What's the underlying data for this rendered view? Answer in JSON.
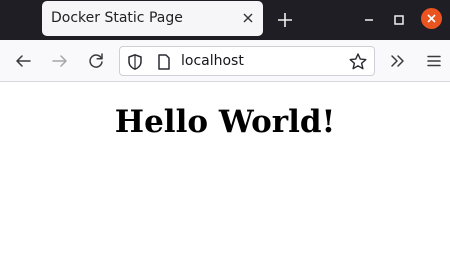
{
  "tab": {
    "title": "Docker Static Page"
  },
  "toolbar": {
    "url": "localhost"
  },
  "page": {
    "heading": "Hello World!"
  },
  "icons": {
    "tab_close": "close-icon",
    "new_tab": "plus-icon",
    "minimize": "minimize-icon",
    "maximize": "maximize-icon",
    "window_close": "window-close-icon",
    "back": "arrow-left-icon",
    "forward": "arrow-right-icon",
    "reload": "reload-icon",
    "tracking_protection": "shield-icon",
    "page_info": "page-icon",
    "bookmark": "star-icon",
    "overflow": "chevron-double-right-icon",
    "menu": "hamburger-menu-icon"
  },
  "colors": {
    "tabbar_bg": "#1f1e24",
    "window_close": "#e95420"
  }
}
